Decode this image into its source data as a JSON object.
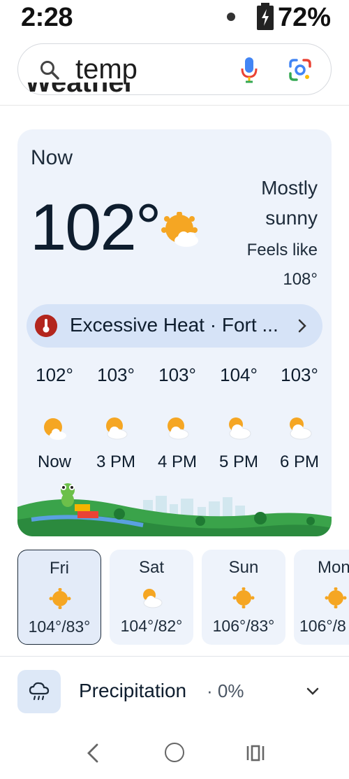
{
  "status_bar": {
    "time": "2:28",
    "battery": "72%"
  },
  "search": {
    "query": "temp"
  },
  "header": {
    "partial_title": "Weather"
  },
  "weather": {
    "now_label": "Now",
    "temperature": "102°",
    "condition_line1": "Mostly",
    "condition_line2": "sunny",
    "feels_like_label": "Feels like",
    "feels_like_value": "108°",
    "alert": {
      "text": "Excessive Heat · Fort ...",
      "color": "#b3261e"
    },
    "hourly": [
      {
        "temp": "102°",
        "time": "Now",
        "icon": "mostly-sunny-icon"
      },
      {
        "temp": "103°",
        "time": "3 PM",
        "icon": "mostly-sunny-icon"
      },
      {
        "temp": "103°",
        "time": "4 PM",
        "icon": "mostly-sunny-icon"
      },
      {
        "temp": "104°",
        "time": "5 PM",
        "icon": "partly-cloudy-icon"
      },
      {
        "temp": "103°",
        "time": "6 PM",
        "icon": "partly-cloudy-icon"
      }
    ]
  },
  "days": [
    {
      "name": "Fri",
      "range": "104°/83°",
      "icon": "sunny-icon",
      "selected": true
    },
    {
      "name": "Sat",
      "range": "104°/82°",
      "icon": "partly-cloudy-icon",
      "selected": false
    },
    {
      "name": "Sun",
      "range": "106°/83°",
      "icon": "sunny-icon",
      "selected": false
    },
    {
      "name": "Mon",
      "range": "106°/8",
      "icon": "sunny-icon",
      "selected": false
    }
  ],
  "precipitation": {
    "label": "Precipitation",
    "value": "· 0%"
  },
  "colors": {
    "accent_blue": "#4285f4",
    "sun_orange": "#f5a623",
    "card_bg": "#eef3fb"
  }
}
